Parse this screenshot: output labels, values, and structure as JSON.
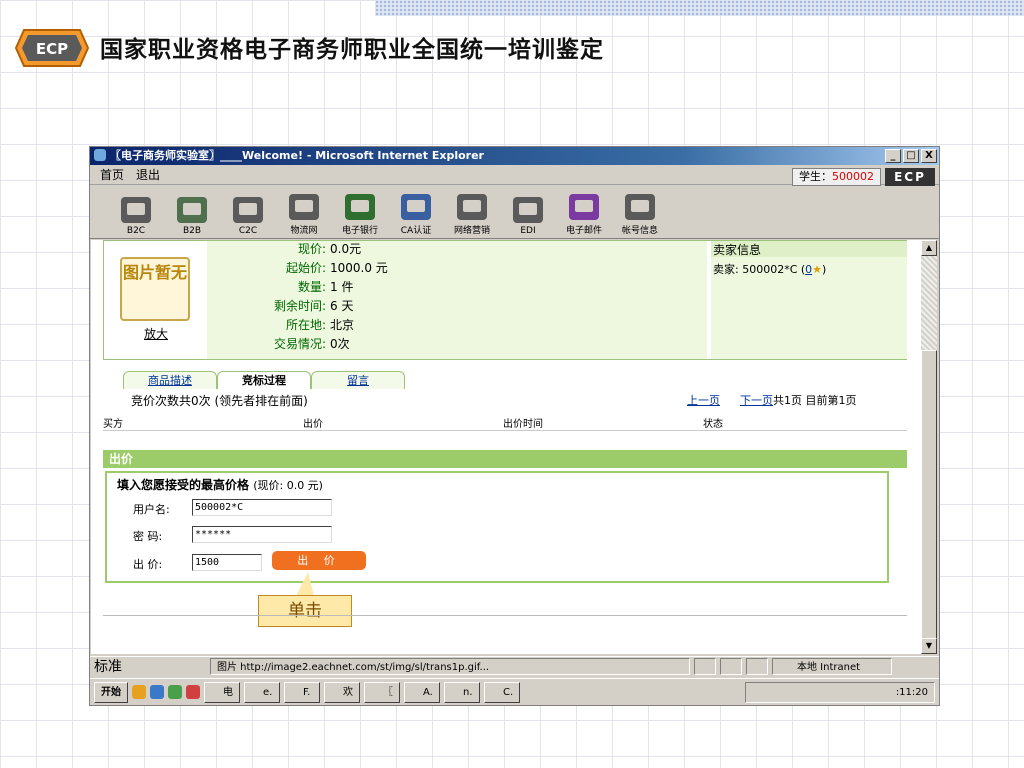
{
  "slide": {
    "logo_text": "ECP",
    "title": "国家职业资格电子商务师职业全国统一培训鉴定"
  },
  "window": {
    "title": "〖电子商务师实验室〗____Welcome! - Microsoft Internet Explorer",
    "controls": [
      "_",
      "□",
      "X"
    ]
  },
  "menu": {
    "home": "首页",
    "logout": "退出",
    "student_label": "学生：",
    "student_id": "500002",
    "badge": "ECP"
  },
  "toolbar": {
    "items": [
      {
        "label": "B2C",
        "icon": "cart-icon"
      },
      {
        "label": "B2B",
        "icon": "network-icon"
      },
      {
        "label": "C2C",
        "icon": "c2c-icon"
      },
      {
        "label": "物流网",
        "icon": "truck-icon"
      },
      {
        "label": "电子银行",
        "icon": "bank-icon"
      },
      {
        "label": "CA认证",
        "icon": "certificate-icon"
      },
      {
        "label": "网络营销",
        "icon": "marketing-icon"
      },
      {
        "label": "EDI",
        "icon": "edi-icon"
      },
      {
        "label": "电子邮件",
        "icon": "mail-icon"
      },
      {
        "label": "帐号信息",
        "icon": "help-icon"
      }
    ]
  },
  "goods": {
    "image_text": "图片暂无",
    "zoom": "放大",
    "rows": [
      {
        "label": "现价:",
        "value": "0.0元"
      },
      {
        "label": "起始价:",
        "value": "1000.0 元"
      },
      {
        "label": "数量:",
        "value": "1 件"
      },
      {
        "label": "剩余时间:",
        "value": "6 天"
      },
      {
        "label": "所在地:",
        "value": "北京"
      },
      {
        "label": "交易情况:",
        "value": "0次"
      }
    ],
    "seller_title": "卖家信息",
    "seller_line_prefix": "卖家: 500002*C (",
    "seller_rating": "0",
    "seller_line_suffix": ")"
  },
  "tabs": [
    "商品描述",
    "竞标过程",
    "留言"
  ],
  "bids": {
    "summary": "竞价次数共0次 (领先者排在前面)",
    "prev": "上一页",
    "next": "下一页",
    "page_info": "共1页 目前第1页",
    "columns": [
      "买方",
      "出价",
      "出价时间",
      "状态"
    ]
  },
  "bid_form": {
    "section_title": "出价",
    "heading": "填入您愿接受的最高价格",
    "current": "(现价: 0.0 元)",
    "username_label": "用户名:",
    "username_value": "500002*C",
    "password_label": "密  码:",
    "password_value": "******",
    "price_label": "出  价:",
    "price_value": "1500",
    "button": "出 价"
  },
  "callout": "单击",
  "status": {
    "ime": "标准",
    "text": "图片 http://image2.eachnet.com/st/img/sl/trans1p.gif...",
    "zone": "本地 Intranet"
  },
  "taskbar": {
    "start": "开始",
    "tasks": [
      "电",
      "e.",
      "F.",
      "欢",
      "〖",
      "A.",
      "n.",
      "C."
    ],
    "clock": ":11:20"
  }
}
